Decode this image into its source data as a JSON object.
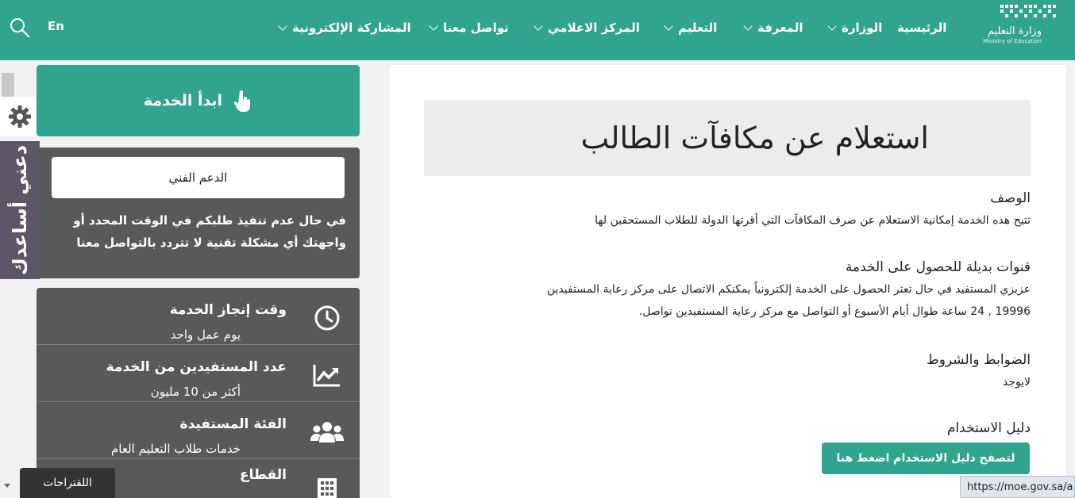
{
  "header": {
    "logo_ar": "وزارة التعليم",
    "logo_en": "Ministry of Education",
    "nav": [
      {
        "label": "الرئيسية",
        "has_menu": false
      },
      {
        "label": "الوزارة",
        "has_menu": true
      },
      {
        "label": "المعرفة",
        "has_menu": true
      },
      {
        "label": "التعليم",
        "has_menu": true
      },
      {
        "label": "المركز الاعلامي",
        "has_menu": true
      },
      {
        "label": "تواصل معنا",
        "has_menu": true
      },
      {
        "label": "المشاركة الإلكترونية",
        "has_menu": true
      }
    ],
    "language": "En",
    "search_icon": "search-icon"
  },
  "side_rail": {
    "settings_icon": "gear-icon",
    "help_tab": "دعني أساعدك"
  },
  "start_service": {
    "label": "ابدأ الخدمة",
    "icon": "hand-pointer-icon"
  },
  "support": {
    "button": "الدعم الفني",
    "text": "في حال عدم تنفيذ طلبكم في الوقت المحدد أو واجهتك أي مشكلة تقنية لا تتردد بالتواصل معنا"
  },
  "service_info": [
    {
      "icon": "clock-icon",
      "title": "وقت إنجاز الخدمة",
      "value": "يوم عمل واحد"
    },
    {
      "icon": "chart-up-icon",
      "title": "عدد المستفيدين من الخدمة",
      "value": "أكثر من 10 مليون"
    },
    {
      "icon": "users-icon",
      "title": "الفئة المستفيدة",
      "value": "خدمات طلاب التعليم العام"
    },
    {
      "icon": "grid-icon",
      "title": "القطاع",
      "value": ""
    }
  ],
  "suggestions_tab": "اللقتراحات",
  "main": {
    "title": "استعلام عن مكافآت الطالب",
    "description_heading": "الوصف",
    "description": "تتيح هذه الخدمة إمكانية الاستعلام عن صرف المكافآت التي أقرتها الدولة للطلاب المستحقين لها",
    "channels_heading": "قنوات بديلة للحصول على الخدمة",
    "channels_line1": "عزيزي المستفيد في حال تعثر الحصول على الخدمة إلكترونياً يمكنكم الاتصال على مركز رعاية المستفيدين",
    "channels_line2": "19996 , 24 ساعة طوال أيام الأسبوع أو التواصل مع مركز رعاية المستفيدين تواصل.",
    "terms_heading": "الضوابط والشروط",
    "terms": "لايوجد",
    "guide_heading": "دليل الاستخدام",
    "guide_button": "لتصفح دليل الاستخدام اضغط هنا"
  },
  "status_url": "https://moe.gov.sa/a",
  "colors": {
    "brand": "#30a48e",
    "dark_panel": "#595959",
    "help_tab": "#5f5568"
  }
}
